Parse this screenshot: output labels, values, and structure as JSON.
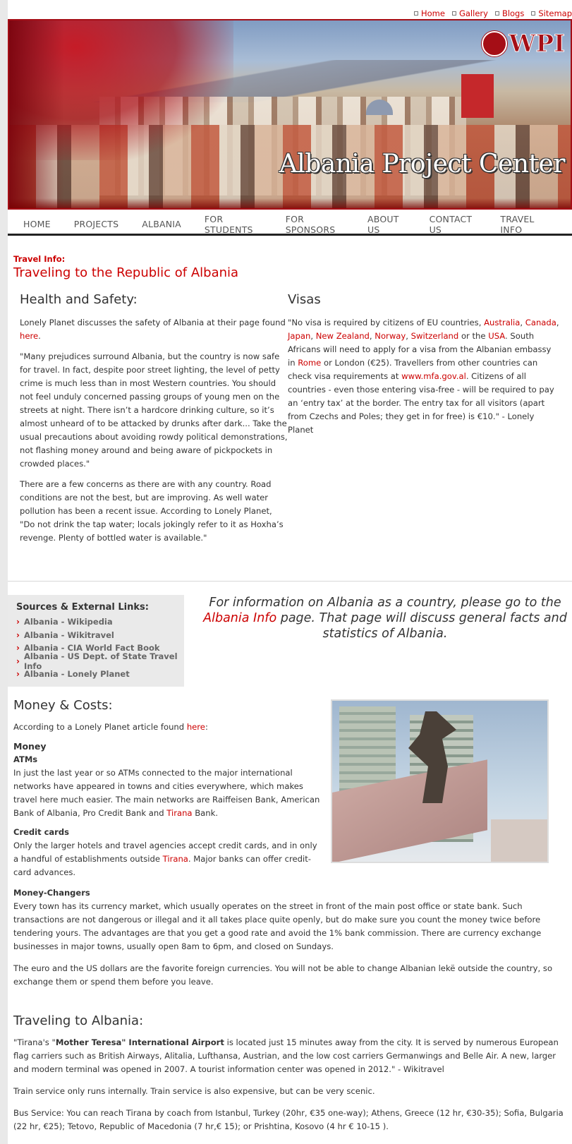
{
  "toplinks": [
    "Home",
    "Gallery",
    "Blogs",
    "Sitemap"
  ],
  "banner": {
    "title": "Albania Project Center",
    "logo_text": "WPI"
  },
  "nav": [
    "HOME",
    "PROJECTS",
    "ALBANIA",
    "FOR STUDENTS",
    "FOR SPONSORS",
    "ABOUT US",
    "CONTACT US",
    "TRAVEL INFO"
  ],
  "kicker": "Travel Info:",
  "page_title": "Traveling to the Republic of Albania",
  "health": {
    "heading": "Health and Safety:",
    "intro_before": "Lonely Planet discusses the safety of Albania at their page found ",
    "intro_link": "here",
    "intro_after": ".",
    "quote": "\"Many prejudices surround Albania, but the country is now safe for travel. In fact, despite poor street lighting, the level of petty crime is much less than in most Western countries. You should not feel unduly concerned passing groups of young men on the streets at night. There isn’t a hardcore drinking culture, so it’s almost unheard of to be attacked by drunks after dark... Take the usual precautions about avoiding rowdy political demonstrations, not flashing money around and being aware of pickpockets in crowded places.\"",
    "concerns": "There are a few concerns as there are with any country. Road conditions are not the best, but are improving. As well water pollution has been a recent issue. According to Lonely Planet, \"Do not drink the tap water; locals jokingly refer to it as Hoxha’s revenge. Plenty of bottled water is available.\""
  },
  "visas": {
    "heading": "Visas",
    "t1": "\"No visa is required by citizens of EU countries, ",
    "countries": [
      "Australia",
      "Canada",
      "Japan",
      "New Zealand",
      "Norway",
      "Switzerland",
      "USA"
    ],
    "t_or_the": " or the ",
    "t2": ". South Africans will need to apply for a visa from the Albanian embassy in ",
    "rome": "Rome",
    "t3": " or London (€25). Travellers from other countries can check visa requirements at ",
    "mfa": "www.mfa.gov.al",
    "t4": ". Citizens of all countries - even those entering visa-free - will be required to pay an ‘entry tax’ at the border. The entry tax for all visitors (apart from Czechs and Poles; they get in for free) is €10.\" - Lonely Planet"
  },
  "sources": {
    "heading": "Sources & External Links:",
    "links": [
      "Albania - Wikipedia",
      "Albania - Wikitravel",
      "Albania - CIA World Fact Book",
      "Albania - US Dept. of State Travel Info",
      "Albania - Lonely Planet"
    ]
  },
  "info_note": {
    "before": "For information on Albania as a country, please go to the ",
    "link": "Albania Info",
    "after": " page. That page will discuss general facts and statistics of Albania."
  },
  "money": {
    "heading": "Money & Costs:",
    "intro_before": "According to a Lonely Planet article found ",
    "intro_link": "here",
    "intro_after": ":",
    "sub_money": "Money",
    "sub_atms": "ATMs",
    "atms_text": "In just the last year or so ATMs connected to the major international networks have appeared in towns and cities everywhere, which makes travel here much easier. The main networks are Raiffeisen Bank, American Bank of Albania, Pro Credit Bank and ",
    "tirana": "Tirana",
    "atms_after": " Bank.",
    "sub_credit": "Credit cards",
    "credit_before": "Only the larger hotels and travel agencies accept credit cards, and in only a handful of establishments outside ",
    "credit_after": ". Major banks can offer credit-card advances.",
    "sub_changers": "Money-Changers",
    "changers_text": "Every town has its currency market, which usually operates on the street in front of the main post office or state bank. Such transactions are not dangerous or illegal and it all takes place quite openly, but do make sure you count the money twice before tendering yours. The advantages are that you get a good rate and avoid the 1% bank commission. There are currency exchange businesses in major towns, usually open 8am to 6pm, and closed on Sundays.",
    "euro_text": "The euro and the US dollars are the favorite foreign currencies. You will not be able to change Albanian lekë outside the country, so exchange them or spend them before you leave."
  },
  "travel": {
    "heading": "Traveling to Albania:",
    "airport_before": "\"Tirana's \"",
    "airport_name": "Mother Teresa",
    "airport_bold2": "\" International Airport",
    "airport_after": " is located just 15 minutes away from the city. It is served by numerous European flag carriers such as British Airways, Alitalia, Lufthansa, Austrian, and the low cost carriers Germanwings and Belle Air. A new, larger and modern terminal was opened in 2007. A tourist information center was opened in 2012.\" - Wikitravel",
    "train": "Train service only runs internally. Train service is also expensive, but can be very scenic.",
    "bus": "Bus Service: You can reach Tirana by coach from Istanbul, Turkey (20hr, €35 one-way); Athens, Greece (12 hr, €30-35); Sofia, Bulgaria (22 hr, €25); Tetovo, Republic of Macedonia (7 hr,€ 15); or Prishtina, Kosovo (4 hr € 10-15 )."
  }
}
